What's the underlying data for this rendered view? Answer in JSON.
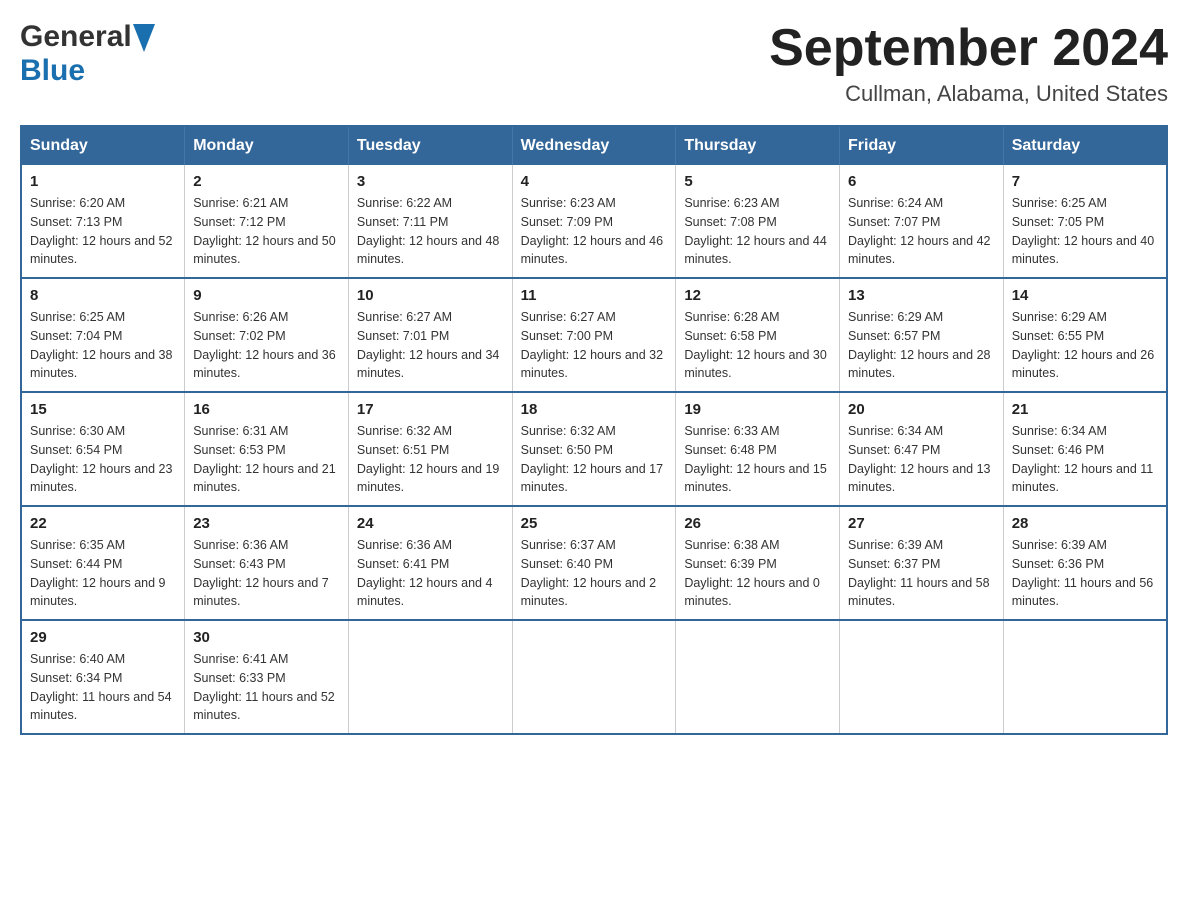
{
  "header": {
    "logo_general": "General",
    "logo_blue": "Blue",
    "main_title": "September 2024",
    "subtitle": "Cullman, Alabama, United States"
  },
  "days_of_week": [
    "Sunday",
    "Monday",
    "Tuesday",
    "Wednesday",
    "Thursday",
    "Friday",
    "Saturday"
  ],
  "weeks": [
    [
      {
        "day": "1",
        "sunrise": "Sunrise: 6:20 AM",
        "sunset": "Sunset: 7:13 PM",
        "daylight": "Daylight: 12 hours and 52 minutes."
      },
      {
        "day": "2",
        "sunrise": "Sunrise: 6:21 AM",
        "sunset": "Sunset: 7:12 PM",
        "daylight": "Daylight: 12 hours and 50 minutes."
      },
      {
        "day": "3",
        "sunrise": "Sunrise: 6:22 AM",
        "sunset": "Sunset: 7:11 PM",
        "daylight": "Daylight: 12 hours and 48 minutes."
      },
      {
        "day": "4",
        "sunrise": "Sunrise: 6:23 AM",
        "sunset": "Sunset: 7:09 PM",
        "daylight": "Daylight: 12 hours and 46 minutes."
      },
      {
        "day": "5",
        "sunrise": "Sunrise: 6:23 AM",
        "sunset": "Sunset: 7:08 PM",
        "daylight": "Daylight: 12 hours and 44 minutes."
      },
      {
        "day": "6",
        "sunrise": "Sunrise: 6:24 AM",
        "sunset": "Sunset: 7:07 PM",
        "daylight": "Daylight: 12 hours and 42 minutes."
      },
      {
        "day": "7",
        "sunrise": "Sunrise: 6:25 AM",
        "sunset": "Sunset: 7:05 PM",
        "daylight": "Daylight: 12 hours and 40 minutes."
      }
    ],
    [
      {
        "day": "8",
        "sunrise": "Sunrise: 6:25 AM",
        "sunset": "Sunset: 7:04 PM",
        "daylight": "Daylight: 12 hours and 38 minutes."
      },
      {
        "day": "9",
        "sunrise": "Sunrise: 6:26 AM",
        "sunset": "Sunset: 7:02 PM",
        "daylight": "Daylight: 12 hours and 36 minutes."
      },
      {
        "day": "10",
        "sunrise": "Sunrise: 6:27 AM",
        "sunset": "Sunset: 7:01 PM",
        "daylight": "Daylight: 12 hours and 34 minutes."
      },
      {
        "day": "11",
        "sunrise": "Sunrise: 6:27 AM",
        "sunset": "Sunset: 7:00 PM",
        "daylight": "Daylight: 12 hours and 32 minutes."
      },
      {
        "day": "12",
        "sunrise": "Sunrise: 6:28 AM",
        "sunset": "Sunset: 6:58 PM",
        "daylight": "Daylight: 12 hours and 30 minutes."
      },
      {
        "day": "13",
        "sunrise": "Sunrise: 6:29 AM",
        "sunset": "Sunset: 6:57 PM",
        "daylight": "Daylight: 12 hours and 28 minutes."
      },
      {
        "day": "14",
        "sunrise": "Sunrise: 6:29 AM",
        "sunset": "Sunset: 6:55 PM",
        "daylight": "Daylight: 12 hours and 26 minutes."
      }
    ],
    [
      {
        "day": "15",
        "sunrise": "Sunrise: 6:30 AM",
        "sunset": "Sunset: 6:54 PM",
        "daylight": "Daylight: 12 hours and 23 minutes."
      },
      {
        "day": "16",
        "sunrise": "Sunrise: 6:31 AM",
        "sunset": "Sunset: 6:53 PM",
        "daylight": "Daylight: 12 hours and 21 minutes."
      },
      {
        "day": "17",
        "sunrise": "Sunrise: 6:32 AM",
        "sunset": "Sunset: 6:51 PM",
        "daylight": "Daylight: 12 hours and 19 minutes."
      },
      {
        "day": "18",
        "sunrise": "Sunrise: 6:32 AM",
        "sunset": "Sunset: 6:50 PM",
        "daylight": "Daylight: 12 hours and 17 minutes."
      },
      {
        "day": "19",
        "sunrise": "Sunrise: 6:33 AM",
        "sunset": "Sunset: 6:48 PM",
        "daylight": "Daylight: 12 hours and 15 minutes."
      },
      {
        "day": "20",
        "sunrise": "Sunrise: 6:34 AM",
        "sunset": "Sunset: 6:47 PM",
        "daylight": "Daylight: 12 hours and 13 minutes."
      },
      {
        "day": "21",
        "sunrise": "Sunrise: 6:34 AM",
        "sunset": "Sunset: 6:46 PM",
        "daylight": "Daylight: 12 hours and 11 minutes."
      }
    ],
    [
      {
        "day": "22",
        "sunrise": "Sunrise: 6:35 AM",
        "sunset": "Sunset: 6:44 PM",
        "daylight": "Daylight: 12 hours and 9 minutes."
      },
      {
        "day": "23",
        "sunrise": "Sunrise: 6:36 AM",
        "sunset": "Sunset: 6:43 PM",
        "daylight": "Daylight: 12 hours and 7 minutes."
      },
      {
        "day": "24",
        "sunrise": "Sunrise: 6:36 AM",
        "sunset": "Sunset: 6:41 PM",
        "daylight": "Daylight: 12 hours and 4 minutes."
      },
      {
        "day": "25",
        "sunrise": "Sunrise: 6:37 AM",
        "sunset": "Sunset: 6:40 PM",
        "daylight": "Daylight: 12 hours and 2 minutes."
      },
      {
        "day": "26",
        "sunrise": "Sunrise: 6:38 AM",
        "sunset": "Sunset: 6:39 PM",
        "daylight": "Daylight: 12 hours and 0 minutes."
      },
      {
        "day": "27",
        "sunrise": "Sunrise: 6:39 AM",
        "sunset": "Sunset: 6:37 PM",
        "daylight": "Daylight: 11 hours and 58 minutes."
      },
      {
        "day": "28",
        "sunrise": "Sunrise: 6:39 AM",
        "sunset": "Sunset: 6:36 PM",
        "daylight": "Daylight: 11 hours and 56 minutes."
      }
    ],
    [
      {
        "day": "29",
        "sunrise": "Sunrise: 6:40 AM",
        "sunset": "Sunset: 6:34 PM",
        "daylight": "Daylight: 11 hours and 54 minutes."
      },
      {
        "day": "30",
        "sunrise": "Sunrise: 6:41 AM",
        "sunset": "Sunset: 6:33 PM",
        "daylight": "Daylight: 11 hours and 52 minutes."
      },
      null,
      null,
      null,
      null,
      null
    ]
  ]
}
